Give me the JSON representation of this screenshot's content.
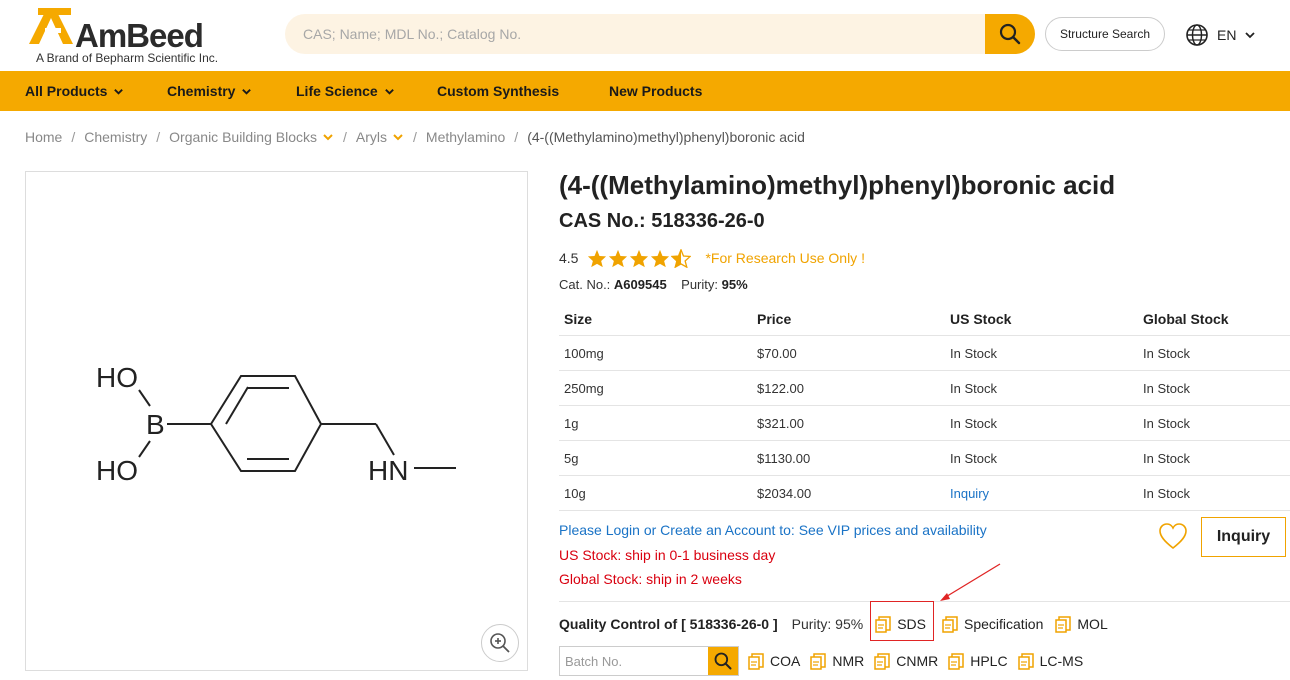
{
  "brand": {
    "logo_text": "AmBeed",
    "tagline": "A Brand of Bepharm Scientific Inc.",
    "accent": "#f5a900"
  },
  "header": {
    "search_placeholder": "CAS; Name; MDL No.; Catalog No.",
    "structure_search": "Structure Search",
    "language": "EN"
  },
  "nav": {
    "items": [
      "All Products",
      "Chemistry",
      "Life Science",
      "Custom Synthesis",
      "New Products"
    ]
  },
  "breadcrumb": {
    "items": [
      "Home",
      "Chemistry",
      "Organic Building Blocks",
      "Aryls",
      "Methylamino"
    ],
    "current": "(4-((Methylamino)methyl)phenyl)boronic acid"
  },
  "structure": {
    "labels": [
      "HO",
      "B",
      "HO",
      "HN"
    ]
  },
  "product": {
    "title": "(4-((Methylamino)methyl)phenyl)boronic acid",
    "cas_label": "CAS No.: 518336-26-0",
    "rating": "4.5",
    "rating_value": 4.5,
    "research_note": "*For Research Use Only !",
    "cat_label": "Cat. No.:",
    "cat_no": "A609545",
    "purity_label": "Purity:",
    "purity": "95%"
  },
  "table": {
    "headers": [
      "Size",
      "Price",
      "US Stock",
      "Global Stock"
    ],
    "rows": [
      [
        "100mg",
        "$70.00",
        "In Stock",
        "In Stock"
      ],
      [
        "250mg",
        "$122.00",
        "In Stock",
        "In Stock"
      ],
      [
        "1g",
        "$321.00",
        "In Stock",
        "In Stock"
      ],
      [
        "5g",
        "$1130.00",
        "In Stock",
        "In Stock"
      ],
      [
        "10g",
        "$2034.00",
        "Inquiry",
        "In Stock"
      ]
    ]
  },
  "info": {
    "login": "Please Login or Create an Account to: See VIP prices and availability",
    "us_ship": "US Stock: ship in 0-1 business day",
    "global_ship": "Global Stock: ship in 2 weeks",
    "inquiry_button": "Inquiry"
  },
  "qc": {
    "label": "Quality Control of [ 518336-26-0 ]",
    "purity": "Purity: 95%",
    "docs": [
      "SDS",
      "Specification",
      "MOL"
    ],
    "batch_placeholder": "Batch No.",
    "batch_docs": [
      "COA",
      "NMR",
      "CNMR",
      "HPLC",
      "LC-MS"
    ]
  }
}
